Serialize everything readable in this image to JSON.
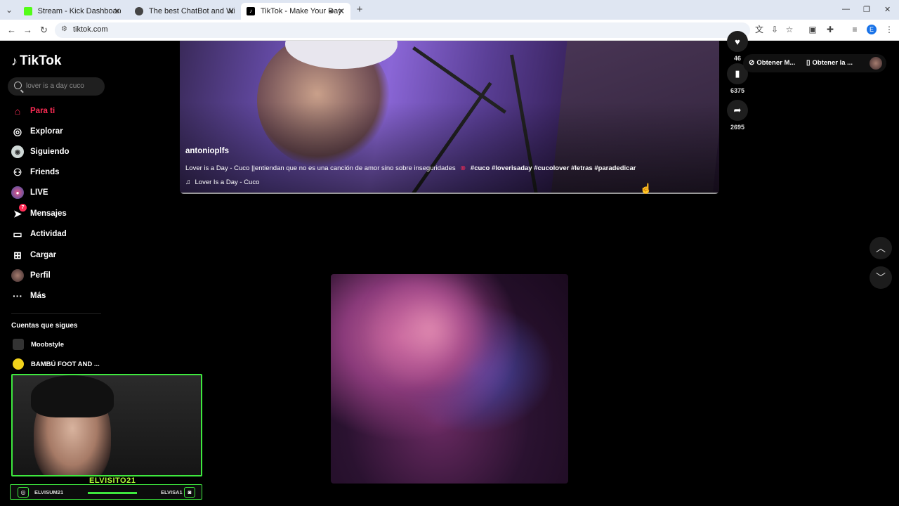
{
  "browser": {
    "tabs": [
      {
        "label": "Stream - Kick Dashboard",
        "favicon_color": "#53fc18"
      },
      {
        "label": "The best ChatBot and Widgets",
        "favicon_color": "#444444"
      },
      {
        "label": "TikTok - Make Your Day",
        "favicon_color": "#000000"
      }
    ],
    "new_tab": "+",
    "url": "tiktok.com",
    "profile_initial": "E"
  },
  "sidebar": {
    "logo": "TikTok",
    "search_placeholder": "lover is a day cuco",
    "items": [
      {
        "label": "Para ti",
        "icon": "home-icon",
        "active": true
      },
      {
        "label": "Explorar",
        "icon": "compass-icon"
      },
      {
        "label": "Siguiendo",
        "icon": "following-icon"
      },
      {
        "label": "Friends",
        "icon": "friends-icon"
      },
      {
        "label": "LIVE",
        "icon": "live-icon"
      },
      {
        "label": "Mensajes",
        "icon": "messages-icon",
        "badge": "7"
      },
      {
        "label": "Actividad",
        "icon": "activity-icon"
      },
      {
        "label": "Cargar",
        "icon": "upload-icon"
      },
      {
        "label": "Perfil",
        "icon": "profile-icon"
      },
      {
        "label": "Más",
        "icon": "more-icon"
      }
    ],
    "following_title": "Cuentas que sigues",
    "following": [
      {
        "name": "Moobstyle"
      },
      {
        "name": "BAMBÚ FOOT AND ..."
      }
    ]
  },
  "video": {
    "username": "antonioplfs",
    "description": "Lover is a Day - Cuco ||entiendan que no es una canción de amor sino sobre  inseguridades",
    "hashtags": "#cuco #loverisaday #cucolover #letras #paradedicar",
    "music": "Lover Is a Day - Cuco"
  },
  "actions": {
    "likes_count": "46",
    "saves_count": "6375",
    "shares_count": "2695"
  },
  "get_app": {
    "button1": "Obtener M...",
    "button2": "Obtener la ..."
  },
  "webcam": {
    "streamer_name": "ELVISITO21",
    "instagram": "ELVISUM21",
    "discord": "ELVISA1"
  },
  "colors": {
    "accent": "#fe2c55",
    "webcam_frame": "#3ee83e"
  }
}
